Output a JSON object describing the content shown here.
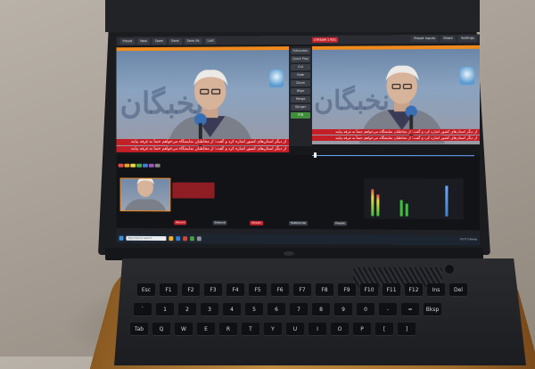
{
  "app": {
    "menu": [
      "Preset",
      "New",
      "Open",
      "Save",
      "Save As",
      "Last"
    ],
    "menu_right": [
      "Preset Inputs",
      "Share",
      "Settings"
    ],
    "rec_badge": "STREAM 1 REC"
  },
  "sidepanel": {
    "buttons": [
      "Fullscreen",
      "Quick Play",
      "Cut",
      "Fade",
      "Zoom",
      "Wipe",
      "Merge",
      "Stinger",
      "FTB"
    ]
  },
  "video": {
    "lower_third_line1": "از دیگر استان‌های کشور اشاره کرد و گفت: از مخاطبان نمایشگاه می‌خواهم حتماً به غرفه بیایند",
    "lower_third_line2": "از دیگر استان‌های کشور اشاره کرد و گفت: از مخاطبان نمایشگاه می‌خواهم حتماً به غرفه بیایند",
    "backdrop_text": "نخبگان"
  },
  "bottom": {
    "buttons": [
      "Record",
      "External",
      "Stream",
      "MultiCorder",
      "Playlist"
    ]
  },
  "taskbar": {
    "search_placeholder": "Type here to search",
    "weather": "21°C Cloudy"
  },
  "keyboard": {
    "row1": [
      "Esc",
      "F1",
      "F2",
      "F3",
      "F4",
      "F5",
      "F6",
      "F7",
      "F8",
      "F9",
      "F10",
      "F11",
      "F12",
      "Ins",
      "Del"
    ],
    "row2": [
      "`",
      "1",
      "2",
      "3",
      "4",
      "5",
      "6",
      "7",
      "8",
      "9",
      "0",
      "-",
      "=",
      "Bksp"
    ],
    "row3": [
      "Tab",
      "Q",
      "W",
      "E",
      "R",
      "T",
      "Y",
      "U",
      "I",
      "O",
      "P",
      "[",
      "]"
    ]
  },
  "colors": {
    "accent_orange": "#f08a1c",
    "lower_third_red": "#c41f26",
    "rec_red": "#c8242c",
    "active_green": "#3f8f3a"
  }
}
